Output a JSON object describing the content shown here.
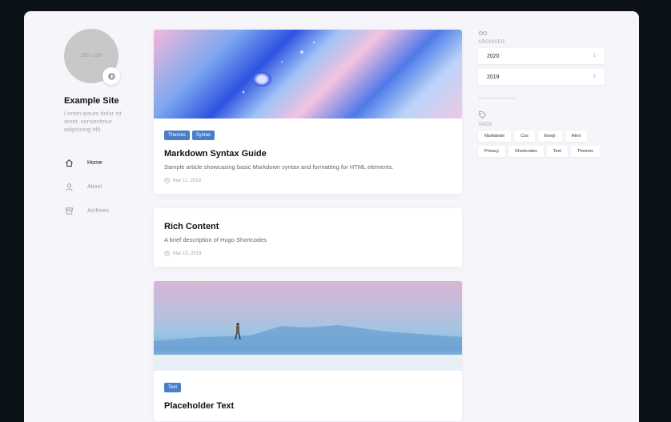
{
  "sidebar": {
    "avatar_text": "150 x 150",
    "emoji": "🍥",
    "title": "Example Site",
    "description": "Lorem ipsum dolor sit amet, consectetur adipiscing elit.",
    "menu": [
      {
        "label": "Home",
        "icon": "home-icon",
        "active": true
      },
      {
        "label": "About",
        "icon": "user-icon",
        "active": false
      },
      {
        "label": "Archives",
        "icon": "archive-icon",
        "active": false
      }
    ]
  },
  "posts": [
    {
      "tags": [
        "Themes",
        "Syntax"
      ],
      "title": "Markdown Syntax Guide",
      "description": "Sample article showcasing basic Markdown syntax and formatting for HTML elements.",
      "date": "Mar 11, 2019"
    },
    {
      "title": "Rich Content",
      "description": "A brief description of Hugo Shortcodes",
      "date": "Mar 10, 2019"
    },
    {
      "tags": [
        "Test"
      ],
      "title": "Placeholder Text"
    }
  ],
  "widgets": {
    "archives_label": "ARCHIVES",
    "archives": [
      {
        "year": "2020",
        "count": "1"
      },
      {
        "year": "2019",
        "count": "5"
      }
    ],
    "tags_label": "TAGS",
    "tags": [
      "Markdown",
      "Css",
      "Emoji",
      "Html",
      "Privacy",
      "Shortcodes",
      "Text",
      "Themes"
    ]
  },
  "colors": {
    "tag_bg": "#4a7ec7",
    "page_bg": "#f5f5fa",
    "outer_bg": "#0b1218"
  }
}
